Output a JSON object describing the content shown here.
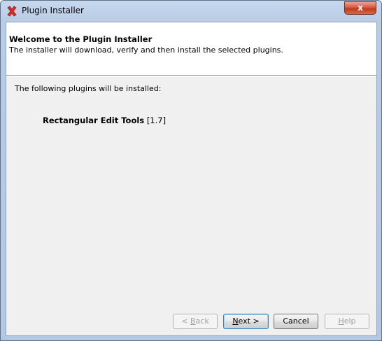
{
  "window": {
    "title": "Plugin Installer",
    "close_label": "x"
  },
  "header": {
    "title": "Welcome to the Plugin Installer",
    "subtitle": "The installer will download, verify and then install the selected plugins."
  },
  "body": {
    "intro": "The following plugins will be installed:",
    "plugins": [
      {
        "name": "Rectangular Edit Tools",
        "version": "[1.7]"
      }
    ]
  },
  "buttons": {
    "back_prefix": "< ",
    "back_mnemonic": "B",
    "back_rest": "ack",
    "next_mnemonic": "N",
    "next_rest": "ext >",
    "cancel": "Cancel",
    "help_mnemonic": "H",
    "help_rest": "elp"
  },
  "colors": {
    "accent": "#3c7fb1",
    "close_button": "#c2391c"
  }
}
